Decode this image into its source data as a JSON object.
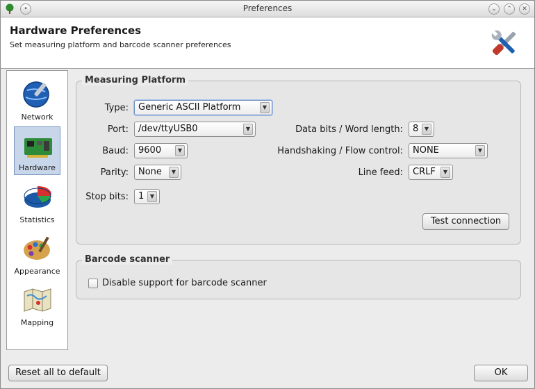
{
  "window": {
    "title": "Preferences"
  },
  "header": {
    "title": "Hardware Preferences",
    "subtitle": "Set measuring platform and barcode scanner preferences",
    "icon": "tools-icon"
  },
  "sidebar": {
    "items": [
      {
        "label": "Network",
        "icon": "network-globe-icon",
        "selected": false
      },
      {
        "label": "Hardware",
        "icon": "hardware-board-icon",
        "selected": true
      },
      {
        "label": "Statistics",
        "icon": "pie-chart-icon",
        "selected": false
      },
      {
        "label": "Appearance",
        "icon": "palette-icon",
        "selected": false
      },
      {
        "label": "Mapping",
        "icon": "map-icon",
        "selected": false
      }
    ]
  },
  "measuring": {
    "title": "Measuring Platform",
    "type_label": "Type:",
    "type_value": "Generic ASCII Platform",
    "port_label": "Port:",
    "port_value": "/dev/ttyUSB0",
    "baud_label": "Baud:",
    "baud_value": "9600",
    "parity_label": "Parity:",
    "parity_value": "None",
    "stopbits_label": "Stop bits:",
    "stopbits_value": "1",
    "databits_label": "Data bits / Word length:",
    "databits_value": "8",
    "handshake_label": "Handshaking / Flow control:",
    "handshake_value": "NONE",
    "linefeed_label": "Line feed:",
    "linefeed_value": "CRLF",
    "test_button": "Test connection"
  },
  "barcode": {
    "title": "Barcode scanner",
    "disable_label": "Disable support for barcode scanner",
    "disable_checked": false
  },
  "footer": {
    "reset_button": "Reset all to default",
    "ok_button": "OK"
  }
}
